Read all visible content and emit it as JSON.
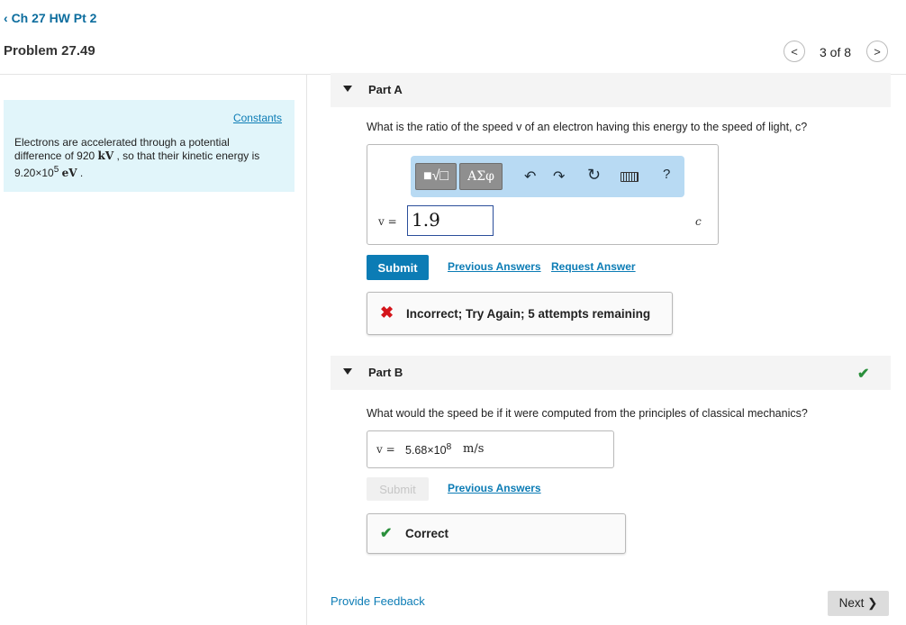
{
  "header": {
    "back_label": "Ch 27 HW Pt 2",
    "problem_title": "Problem 27.49",
    "prev_icon": "<",
    "page_counter": "3 of 8",
    "next_icon": ">"
  },
  "sidebar": {
    "constants_label": "Constants",
    "text_line1": "Electrons are accelerated through a potential",
    "text_line2_pre": "difference of 920",
    "text_line2_unit": "kV",
    "text_line2_post": ", so that their kinetic energy is",
    "text_line3_mant": "9.20×10",
    "text_line3_exp": "5",
    "text_line3_unit": "eV",
    "text_line3_post": "."
  },
  "partA": {
    "title": "Part A",
    "question": "What is the ratio of the speed v of an electron having this energy to the speed of light, c?",
    "toolbar": {
      "templates_label": "■√□",
      "greek_label": "ΑΣφ",
      "undo_icon": "↶",
      "redo_icon": "↷",
      "reset_icon": "↻",
      "help_label": "?"
    },
    "variable_label": "v =",
    "input_value": "1.9",
    "unit": "c",
    "submit_label": "Submit",
    "previous_answers_label": "Previous Answers",
    "request_answer_label": "Request Answer",
    "feedback_icon": "✖",
    "feedback_text": "Incorrect; Try Again; 5 attempts remaining"
  },
  "partB": {
    "title": "Part B",
    "status_icon": "✔",
    "question": "What would the speed be if it were computed from the principles of classical mechanics?",
    "variable_label": "v =",
    "value_mant": "5.68×10",
    "value_exp": "8",
    "unit": "m/s",
    "submit_label": "Submit",
    "previous_answers_label": "Previous Answers",
    "feedback_icon": "✔",
    "feedback_text": "Correct"
  },
  "footer": {
    "provide_feedback_label": "Provide Feedback",
    "next_label": "Next ❯"
  },
  "colors": {
    "accent": "#0c7cb5",
    "constants_bg": "#e1f5fa",
    "toolbar_bg": "#b8daf3",
    "error": "#d4151b",
    "success": "#2a8f3b"
  }
}
